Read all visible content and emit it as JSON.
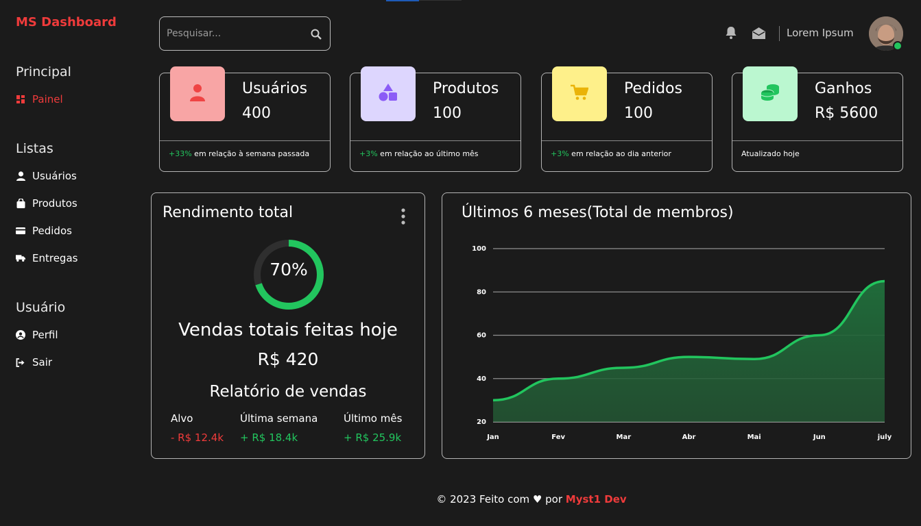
{
  "app": {
    "logo": "MS Dashboard"
  },
  "sidebar": {
    "sections": [
      {
        "title": "Principal",
        "items": [
          {
            "label": "Painel",
            "icon": "dashboard-icon",
            "active": true
          }
        ]
      },
      {
        "title": "Listas",
        "items": [
          {
            "label": "Usuários",
            "icon": "user-icon"
          },
          {
            "label": "Produtos",
            "icon": "shopping-bag-icon"
          },
          {
            "label": "Pedidos",
            "icon": "credit-card-icon"
          },
          {
            "label": "Entregas",
            "icon": "truck-icon"
          }
        ]
      },
      {
        "title": "Usuário",
        "items": [
          {
            "label": "Perfil",
            "icon": "user-circle-icon"
          },
          {
            "label": "Sair",
            "icon": "sign-out-icon"
          }
        ]
      }
    ]
  },
  "header": {
    "search": {
      "placeholder": "Pesquisar...",
      "value": ""
    },
    "username": "Lorem Ipsum",
    "icons": [
      "bell-icon",
      "envelope-open-icon",
      "search-icon"
    ],
    "status_color": "#22c55e"
  },
  "cards": [
    {
      "title": "Usuários",
      "value": "400",
      "change": "+33%",
      "note": "em relação à semana passada",
      "icon": "user-icon",
      "tile_color": "#f8a5a5",
      "icon_color": "#ef4444"
    },
    {
      "title": "Produtos",
      "value": "100",
      "change": "+3%",
      "note": "em relação ao último mês",
      "icon": "shapes-icon",
      "tile_color": "#ddd6fe",
      "icon_color": "#8b5cf6"
    },
    {
      "title": "Pedidos",
      "value": "100",
      "change": "+3%",
      "note": "em relação ao dia anterior",
      "icon": "cart-icon",
      "tile_color": "#fef08a",
      "icon_color": "#eab308"
    },
    {
      "title": "Ganhos",
      "value": "R$ 5600",
      "change": "",
      "note": "Atualizado hoje",
      "icon": "coins-icon",
      "tile_color": "#bbf7d0",
      "icon_color": "#22c55e"
    }
  ],
  "revenue": {
    "title": "Rendimento total",
    "progress_label": "70%",
    "progress": 0.7,
    "sales_title": "Vendas totais feitas hoje",
    "sales_value": "R$ 420",
    "report_title": "Relatório de vendas",
    "report": [
      {
        "label": "Alvo",
        "value": "- R$ 12.4k",
        "trend": "negative"
      },
      {
        "label": "Última semana",
        "value": "+ R$ 18.4k",
        "trend": "positive"
      },
      {
        "label": "Último mês",
        "value": "+ R$ 25.9k",
        "trend": "positive"
      }
    ]
  },
  "chart_title": "Últimos 6 meses(Total de membros)",
  "chart_data": {
    "type": "area",
    "categories": [
      "Jan",
      "Fev",
      "Mar",
      "Abr",
      "Mai",
      "Jun",
      "july"
    ],
    "series": [
      {
        "values": [
          30,
          40,
          45,
          50,
          49,
          60,
          85
        ]
      }
    ],
    "ylim": [
      20,
      100
    ],
    "yticks": [
      20,
      40,
      60,
      80,
      100
    ],
    "grid": true,
    "line_color": "#22c55e",
    "fill_color": "#245a35"
  },
  "footer": {
    "prefix": "© 2023 Feito com",
    "heart": "♥",
    "middle": "por",
    "brand": "Myst1 Dev"
  }
}
